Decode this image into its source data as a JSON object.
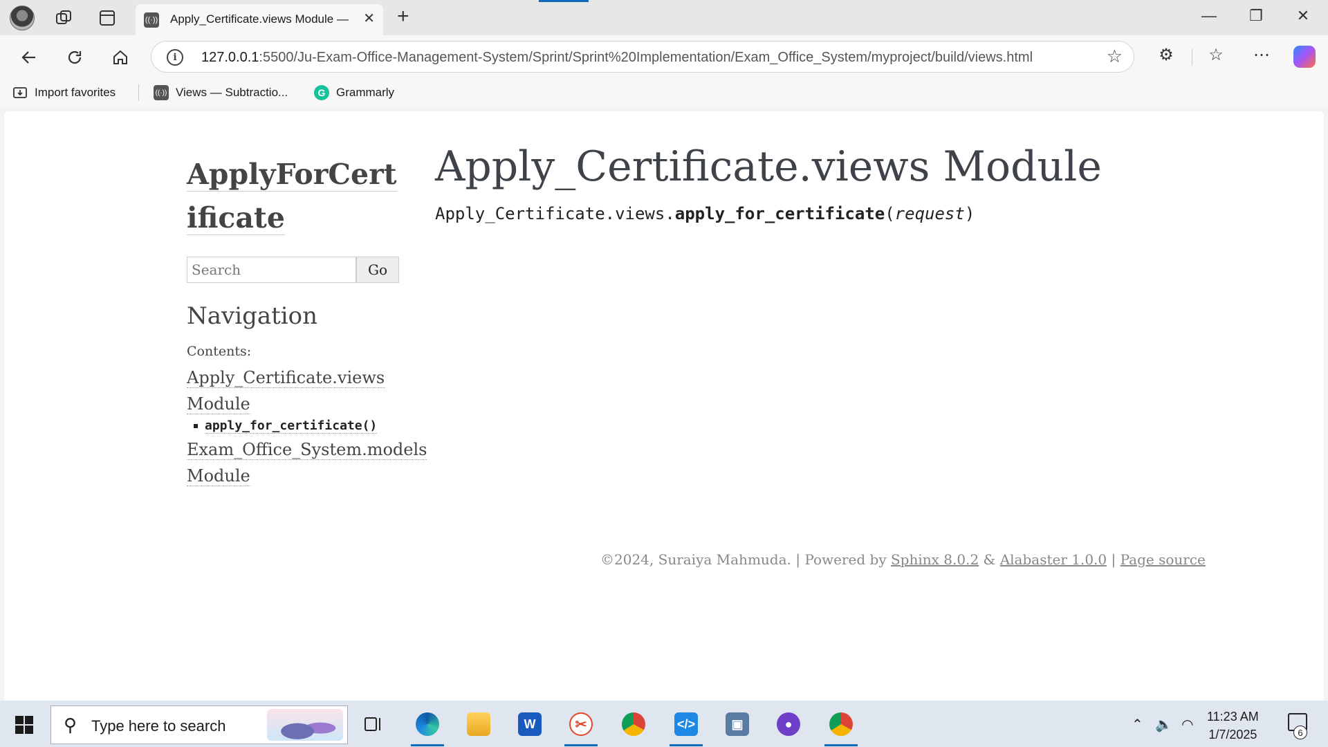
{
  "browser": {
    "tab": {
      "title": "Apply_Certificate.views Module —",
      "favicon": "podcast-icon"
    },
    "address": {
      "host": "127.0.0.1",
      "path": ":5500/Ju-Exam-Office-Management-System/Sprint/Sprint%20Implementation/Exam_Office_System/myproject/build/views.html"
    },
    "favorites": [
      {
        "label": "Import favorites",
        "icon": "import-favorites-icon"
      },
      {
        "label": "Views — Subtractio...",
        "icon": "podcast-icon"
      },
      {
        "label": "Grammarly",
        "icon": "grammarly-icon"
      }
    ]
  },
  "sidebar": {
    "logo": "ApplyForCertificate",
    "search": {
      "placeholder": "Search",
      "button": "Go"
    },
    "nav_heading": "Navigation",
    "contents_label": "Contents:",
    "toc": [
      {
        "label": "Apply_Certificate.views Module"
      },
      {
        "label": "apply_for_certificate()"
      },
      {
        "label": "Exam_Office_System.models Module"
      }
    ]
  },
  "main": {
    "heading": "Apply_Certificate.views Module",
    "signature": {
      "prefix": "Apply_Certificate.views.",
      "name": "apply_for_certificate",
      "open": "(",
      "param": "request",
      "close": ")"
    }
  },
  "footer": {
    "copyright": "©2024, Suraiya Mahmuda. | Powered by ",
    "sphinx": "Sphinx 8.0.2",
    "amp": " & ",
    "alabaster": "Alabaster 1.0.0",
    "pipe": " | ",
    "source": "Page source"
  },
  "taskbar": {
    "search_placeholder": "Type here to search",
    "time": "11:23 AM",
    "date": "1/7/2025",
    "notifications": "6"
  },
  "colors": {
    "accent": "#0f6cbd",
    "page_text": "#3e4349",
    "link": "#444444"
  }
}
